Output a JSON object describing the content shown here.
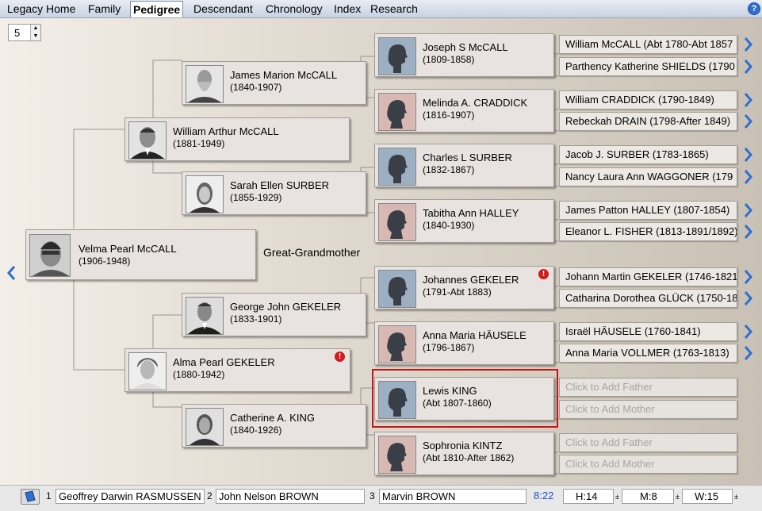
{
  "menu": {
    "tabs": [
      {
        "label": "Legacy Home"
      },
      {
        "label": "Family"
      },
      {
        "label": "Pedigree"
      },
      {
        "label": "Descendant"
      },
      {
        "label": "Chronology"
      },
      {
        "label": "Index"
      },
      {
        "label": "Research"
      }
    ],
    "active_tab": "Pedigree",
    "help_glyph": "?"
  },
  "generations": {
    "value": "5"
  },
  "root": {
    "name": "Velma Pearl McCALL",
    "dates": "(1906-1948)"
  },
  "relation_label": "Great-Grandmother",
  "gen2": [
    {
      "name": "William Arthur McCALL",
      "dates": "(1881-1949)"
    },
    {
      "name": "Alma Pearl GEKELER",
      "dates": "(1880-1942)"
    }
  ],
  "gen3": [
    {
      "name": "James Marion McCALL",
      "dates": "(1840-1907)"
    },
    {
      "name": "Sarah Ellen SURBER",
      "dates": "(1855-1929)"
    },
    {
      "name": "George John GEKELER",
      "dates": "(1833-1901)"
    },
    {
      "name": "Catherine A. KING",
      "dates": "(1840-1926)"
    }
  ],
  "gen4": [
    {
      "name": "Joseph S McCALL",
      "dates": "(1809-1858)"
    },
    {
      "name": "Melinda A. CRADDICK",
      "dates": "(1816-1907)"
    },
    {
      "name": "Charles L SURBER",
      "dates": "(1832-1867)"
    },
    {
      "name": "Tabitha Ann HALLEY",
      "dates": "(1840-1930)"
    },
    {
      "name": "Johannes GEKELER",
      "dates": "(1791-Abt 1883)"
    },
    {
      "name": "Anna Maria HÄUSELE",
      "dates": "(1796-1867)"
    },
    {
      "name": "Lewis KING",
      "dates": "(Abt 1807-1860)"
    },
    {
      "name": "Sophronia KINTZ",
      "dates": "(Abt 1810-After 1862)"
    }
  ],
  "gen5": [
    "William McCALL (Abt 1780-Abt 1857",
    "Parthency Katherine SHIELDS (1790",
    "William CRADDICK (1790-1849)",
    "Rebeckah DRAIN (1798-After 1849)",
    "Jacob J. SURBER (1783-1865)",
    "Nancy Laura Ann WAGGONER (179",
    "James Patton HALLEY (1807-1854)",
    "Eleanor L. FISHER (1813-1891/1892)",
    "Johann Martin GEKELER (1746-1821",
    "Catharina Dorothea GLÜCK (1750-18",
    "Israël HÄUSELE (1760-1841)",
    "Anna Maria VOLLMER (1763-1813)",
    "Click to Add Father",
    "Click to Add Mother",
    "Click to Add Father",
    "Click to Add Mother"
  ],
  "status": {
    "bookmark_1_num": "1",
    "bookmark_1": "Geoffrey Darwin RASMUSSEN",
    "bookmark_2_num": "2",
    "bookmark_2": "John Nelson BROWN",
    "bookmark_3_num": "3",
    "bookmark_3": "Marvin BROWN",
    "time": "8:22",
    "h": "H:14",
    "m": "M:8",
    "w": "W:15"
  },
  "colors": {
    "male_silhouette_bg": "#9db0c3",
    "female_silhouette_bg": "#d7b8b3",
    "selected_border": "#c81414",
    "nav_arrow": "#2f6fd0",
    "warning": "#d21b1b"
  }
}
